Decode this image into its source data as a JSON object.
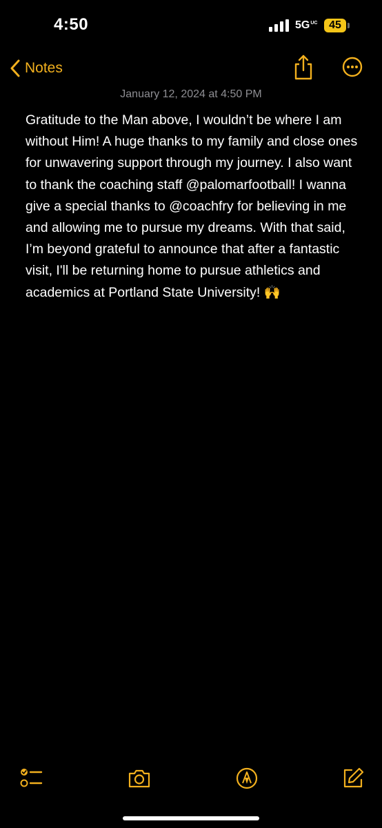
{
  "status_bar": {
    "time": "4:50",
    "network": "5G",
    "network_suffix": "UC",
    "battery": "45"
  },
  "nav": {
    "back_label": "Notes",
    "icons": [
      "chevron-left-icon",
      "share-icon",
      "more-icon"
    ]
  },
  "note": {
    "date": "January 12, 2024 at 4:50 PM",
    "body": "Gratitude to the Man above, I wouldn’t be where I am without Him! A huge thanks to my family and close ones for unwavering support through my journey. I also want to thank the coaching staff @palomarfootball! I wanna give a special thanks to @coachfry for believing in me and allowing me to pursue my dreams. With that said, I’m beyond grateful to announce that after a fantastic visit, I'll be returning home to pursue athletics and academics at Portland State University! 🙌"
  },
  "toolbar": {
    "icons": [
      "checklist-icon",
      "camera-icon",
      "markup-icon",
      "compose-icon"
    ]
  },
  "colors": {
    "accent": "#f2b01e",
    "background": "#000000",
    "text": "#ffffff",
    "secondary_text": "#8e8e93",
    "battery": "#f5c518"
  }
}
